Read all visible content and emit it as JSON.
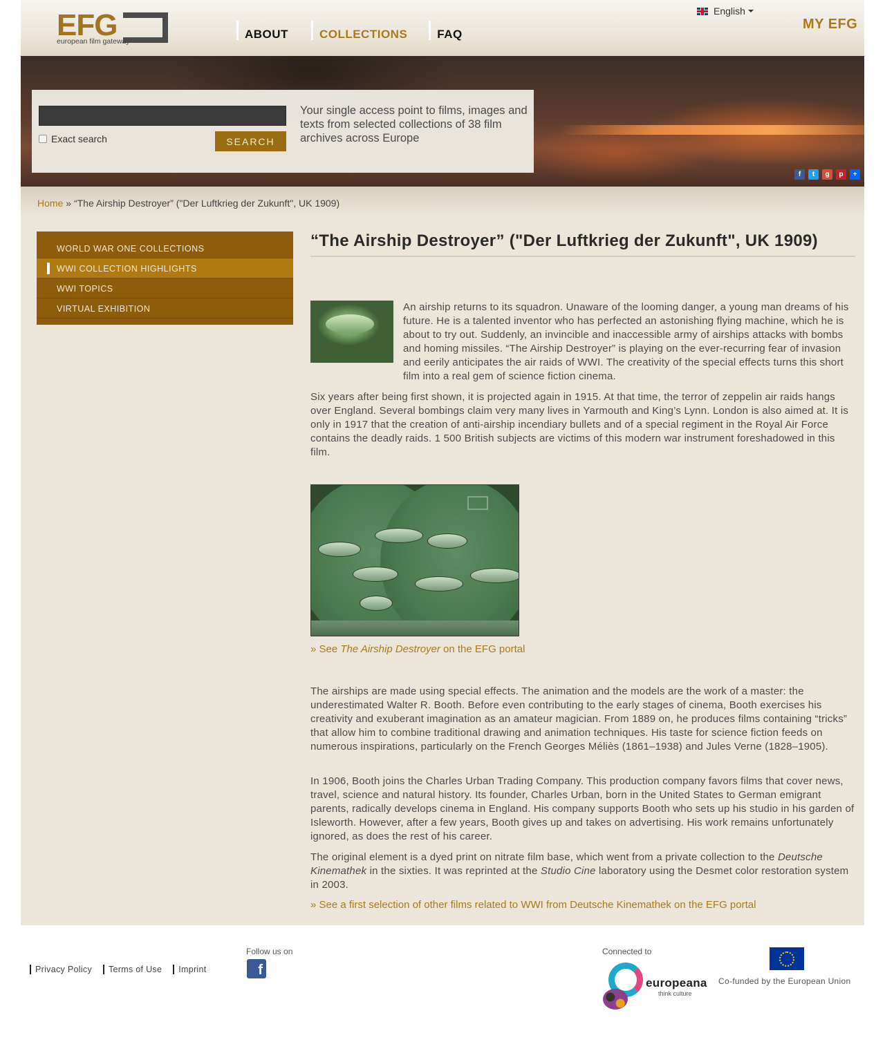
{
  "header": {
    "logo_text": "EFG",
    "logo_tagline": "european film gateway",
    "nav": [
      {
        "label": "ABOUT"
      },
      {
        "label": "COLLECTIONS"
      },
      {
        "label": "FAQ"
      }
    ],
    "language": "English",
    "my_efg": "MY EFG"
  },
  "search": {
    "exact_label": "Exact search",
    "button_label": "SEARCH",
    "tagline": "Your single access point to films, images and texts from selected collections of 38 film archives across Europe"
  },
  "share_icons": [
    "facebook-icon",
    "twitter-icon",
    "google-plus-icon",
    "pinterest-icon",
    "share-plus-icon"
  ],
  "breadcrumb": {
    "home": "Home",
    "separator": "»",
    "current": "“The Airship Destroyer” (\"Der Luftkrieg der Zukunft\", UK 1909)"
  },
  "sidebar": {
    "items": [
      {
        "label": "WORLD WAR ONE COLLECTIONS"
      },
      {
        "label": "WWI COLLECTION HIGHLIGHTS"
      },
      {
        "label": "WWI TOPICS"
      },
      {
        "label": "VIRTUAL EXHIBITION"
      }
    ]
  },
  "article": {
    "title": "“The Airship Destroyer” (\"Der Luftkrieg der Zukunft\", UK 1909)",
    "intro": "An airship returns to its squadron. Unaware of the looming danger, a young man dreams of his future. He is a talented inventor who has perfected an astonishing flying machine, which he is about to try out. Suddenly, an invincible and inaccessible army of airships attacks with bombs and homing missiles. “The Airship Destroyer” is playing on the ever-recurring fear of invasion and eerily anticipates the air raids of WWI. The creativity of the special effects turns this short film into a real gem of science fiction cinema.",
    "p2": "Six years after being first shown, it is projected again in 1915. At that time, the terror of zeppelin air raids hangs over England. Several bombings claim very many lives in Yarmouth and King’s Lynn. London is also aimed at. It is only in 1917 that the creation of anti-airship incendiary bullets and of a special regiment in the Royal Air Force contains the deadly raids. 1 500 British subjects are victims of this modern war instrument foreshadowed in this film.",
    "see_prefix": "» See ",
    "see_title": "The Airship Destroyer",
    "see_suffix": " on the EFG portal",
    "p3": "The airships are made using special effects. The animation and the models are the work of a master: the underestimated Walter R. Booth. Before even contributing to the early stages of cinema, Booth exercises his creativity and exuberant imagination as an amateur magician. From 1889 on, he produces films containing “tricks” that allow him to combine traditional drawing and animation techniques. His taste for science fiction feeds on numerous inspirations, particularly on the French Georges Méliès (1861–1938) and Jules Verne (1828–1905).",
    "p4": "In 1906, Booth joins the Charles Urban Trading Company. This production company favors films that cover news, travel, science and natural history. Its founder, Charles Urban, born in the United States to German emigrant parents, radically develops cinema in England. His company supports Booth who sets up his studio in his garden of Isleworth. However, after a few years, Booth gives up and takes on advertising. His work remains unfortunately ignored, as does the rest of his career.",
    "p5_a": "The original element is a dyed print on nitrate film base, which went from a private collection to the ",
    "p5_b": "Deutsche Kinemathek",
    "p5_c": " in the sixties. It was reprinted at the ",
    "p5_d": "Studio Cine",
    "p5_e": " laboratory using the Desmet color restoration system in 2003.",
    "related_link": "» See a first selection of other films related to WWI from Deutsche Kinemathek on the EFG portal"
  },
  "footer": {
    "links": [
      {
        "label": "Privacy Policy"
      },
      {
        "label": "Terms of Use"
      },
      {
        "label": "Imprint"
      }
    ],
    "follow_label": "Follow us on",
    "connected_label": "Connected to",
    "europeana_word": "europeana",
    "europeana_sub": "think culture",
    "cofunded": "Co-funded by the European Union"
  },
  "colors": {
    "accent": "#a87a1a",
    "sidebar": "#8e5d0c",
    "page_bg": "#ece6da"
  }
}
